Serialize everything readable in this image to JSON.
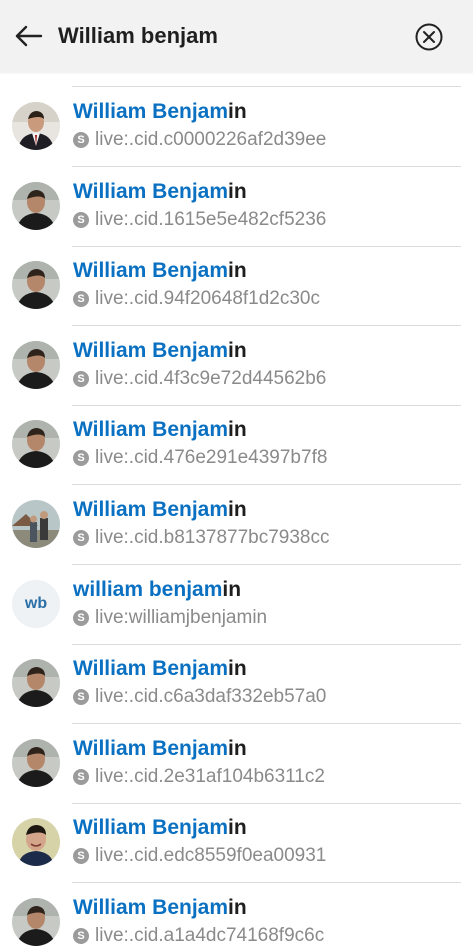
{
  "header": {
    "back_icon": "arrow-left-icon",
    "search_value": "William benjam",
    "clear_icon": "circle-x-icon"
  },
  "results": [
    {
      "name_match": "William Benjam",
      "name_rest": "in",
      "id": "live:.cid.c0000226af2d39ee",
      "avatar": "photo-suit"
    },
    {
      "name_match": "William Benjam",
      "name_rest": "in",
      "id": "live:.cid.1615e5e482cf5236",
      "avatar": "photo-dark"
    },
    {
      "name_match": "William Benjam",
      "name_rest": "in",
      "id": "live:.cid.94f20648f1d2c30c",
      "avatar": "photo-dark"
    },
    {
      "name_match": "William Benjam",
      "name_rest": "in",
      "id": "live:.cid.4f3c9e72d44562b6",
      "avatar": "photo-dark"
    },
    {
      "name_match": "William Benjam",
      "name_rest": "in",
      "id": "live:.cid.476e291e4397b7f8",
      "avatar": "photo-dark"
    },
    {
      "name_match": "William Benjam",
      "name_rest": "in",
      "id": "live:.cid.b8137877bc7938cc",
      "avatar": "photo-outdoor"
    },
    {
      "name_match": "william benjam",
      "name_rest": "in",
      "id": "live:williamjbenjamin",
      "avatar": "initials",
      "initials": "wb"
    },
    {
      "name_match": "William Benjam",
      "name_rest": "in",
      "id": "live:.cid.c6a3daf332eb57a0",
      "avatar": "photo-dark"
    },
    {
      "name_match": "William Benjam",
      "name_rest": "in",
      "id": "live:.cid.2e31af104b6311c2",
      "avatar": "photo-dark"
    },
    {
      "name_match": "William Benjam",
      "name_rest": "in",
      "id": "live:.cid.edc8559f0ea00931",
      "avatar": "photo-smile"
    },
    {
      "name_match": "William Benjam",
      "name_rest": "in",
      "id": "live:.cid.a1a4dc74168f9c6c",
      "avatar": "photo-dark"
    }
  ],
  "colors": {
    "highlight": "#0a70c2",
    "header_bg": "#f2f2f2",
    "secondary_text": "#8a8a8a"
  }
}
